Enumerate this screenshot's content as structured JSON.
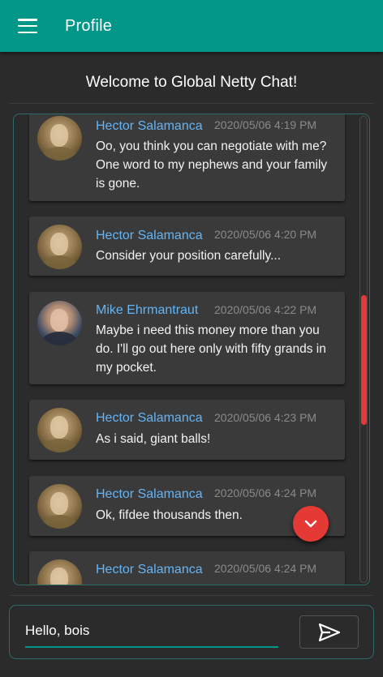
{
  "appbar": {
    "title": "Profile",
    "menu_icon": "hamburger-menu-icon",
    "color": "#009688"
  },
  "welcome": "Welcome to Global Netty Chat!",
  "messages": [
    {
      "author": "Hector Salamanca",
      "time": "2020/05/06 4:19 PM",
      "text": "Oo, you think you can negotiate with me? One word to my nephews and your family is gone.",
      "avatar": "hector"
    },
    {
      "author": "Hector Salamanca",
      "time": "2020/05/06 4:20 PM",
      "text": "Consider your position carefully...",
      "avatar": "hector"
    },
    {
      "author": "Mike Ehrmantraut",
      "time": "2020/05/06 4:22 PM",
      "text": "Maybe i need this money more than you do. I'll go out here only with fifty grands in my pocket.",
      "avatar": "mike"
    },
    {
      "author": "Hector Salamanca",
      "time": "2020/05/06 4:23 PM",
      "text": "As i said, giant balls!",
      "avatar": "hector"
    },
    {
      "author": "Hector Salamanca",
      "time": "2020/05/06 4:24 PM",
      "text": "Ok, fifdee thousands then.",
      "avatar": "hector"
    },
    {
      "author": "Hector Salamanca",
      "time": "2020/05/06 4:24 PM",
      "text": "",
      "avatar": "hector"
    }
  ],
  "scroll_down_icon": "chevron-down-icon",
  "composer": {
    "value": "Hello, bois",
    "send_icon": "send-icon"
  },
  "colors": {
    "accent": "#009688",
    "author": "#64b5f6",
    "danger": "#e53935"
  }
}
